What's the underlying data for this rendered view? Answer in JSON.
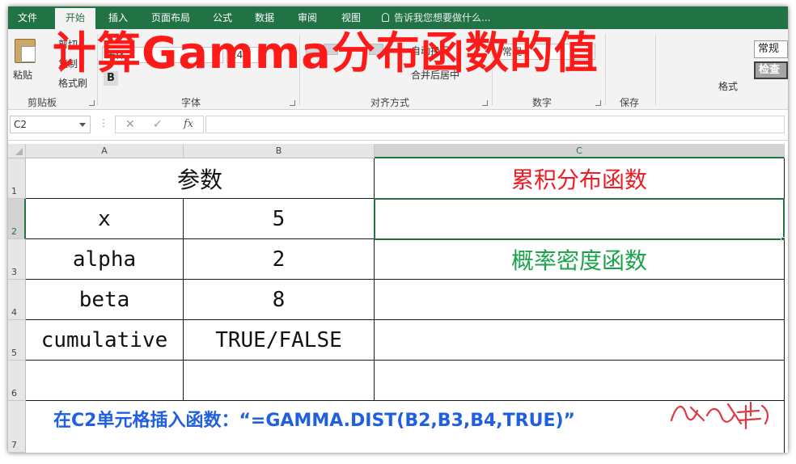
{
  "ribbon_tabs": [
    "文件",
    "开始",
    "插入",
    "页面布局",
    "公式",
    "数据",
    "审阅",
    "视图"
  ],
  "tell_me": "告诉我您想要做什么...",
  "ribbon": {
    "paste_label": "粘贴",
    "cut_label": "剪切",
    "copy_label": "复制",
    "format_painter_label": "格式刷",
    "font_name": "宋体",
    "font_size": "24",
    "bold_label": "B",
    "wrap_text": "自动换行",
    "merge_center": "合并后居中",
    "number_format": "常规",
    "format_label": "格式",
    "style_normal": "常规",
    "style_check": "检查",
    "groups": [
      "剪贴板",
      "字体",
      "对齐方式",
      "数字",
      "保存"
    ]
  },
  "overlay_title": "计算Gamma分布函数的值",
  "formula_bar": {
    "name_box": "C2",
    "more": "⋮",
    "cancel": "✕",
    "enter": "✓",
    "fx": "fx",
    "value": ""
  },
  "columns": [
    "A",
    "B",
    "C"
  ],
  "rows": [
    "1",
    "2",
    "3",
    "4",
    "5",
    "6",
    "7"
  ],
  "cells": {
    "a1_b1": "参数",
    "c1": "累积分布函数",
    "a2": "x",
    "b2": "5",
    "c2": "",
    "a3": "alpha",
    "b3": "2",
    "c3": "概率密度函数",
    "a4": "beta",
    "b4": "8",
    "c4": "",
    "a5": "cumulative",
    "b5": "TRUE/FALSE",
    "c5": ""
  },
  "note": "在C2单元格插入函数：“=GAMMA.DIST(B2,B3,B4,TRUE)”",
  "colors": {
    "excel_green": "#217346",
    "title_red": "#ff1a1a",
    "cdf_red": "#ee1c24",
    "pdf_green": "#1aa34a",
    "note_blue": "#1f5fe0"
  }
}
